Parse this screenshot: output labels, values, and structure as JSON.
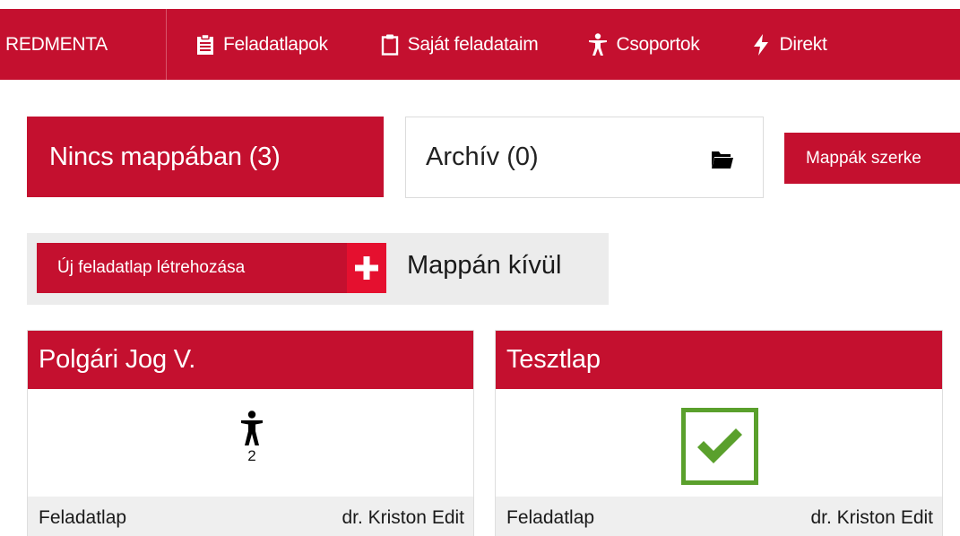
{
  "nav": {
    "brand": "REDMENTA",
    "items": [
      {
        "label": "Feladatlapok",
        "icon": "clipboard-list-icon"
      },
      {
        "label": "Saját feladataim",
        "icon": "clipboard-icon"
      },
      {
        "label": "Csoportok",
        "icon": "person-icon"
      },
      {
        "label": "Direkt",
        "icon": "bolt-icon"
      }
    ]
  },
  "folders": {
    "current": "Nincs mappában (3)",
    "archive": "Archív (0)",
    "edit": "Mappák szerke"
  },
  "new_sheet": {
    "button": "Új feladatlap létrehozása",
    "location": "Mappán kívül"
  },
  "cards": [
    {
      "title": "Polgári Jog V.",
      "indicator": "person-icon",
      "count": "2",
      "type": "Feladatlap",
      "author": "dr. Kriston Edit"
    },
    {
      "title": "Tesztlap",
      "indicator": "checkmark-icon",
      "type": "Feladatlap",
      "author": "dr. Kriston Edit"
    }
  ],
  "colors": {
    "brand": "#c4102f",
    "plus": "#e5102f",
    "check": "#5aa02c"
  }
}
